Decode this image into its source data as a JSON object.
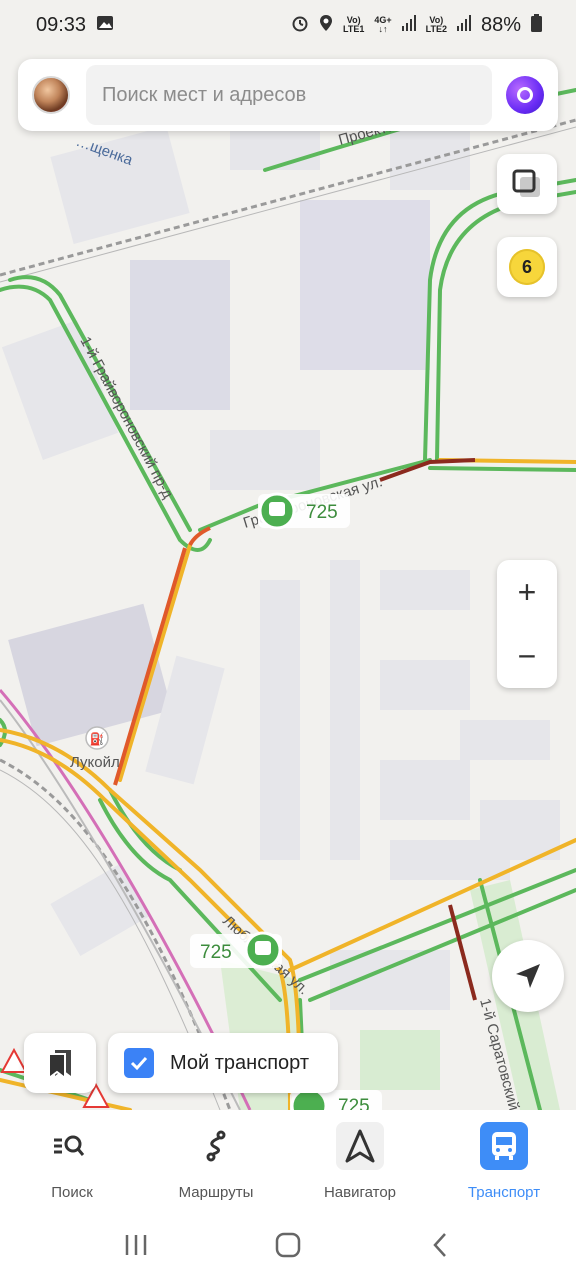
{
  "status_bar": {
    "time": "09:33",
    "battery": "88%",
    "sim1": "LTE1",
    "sim2": "LTE2",
    "net_type": "4G+"
  },
  "search": {
    "placeholder": "Поиск мест и адресов"
  },
  "traffic": {
    "level": "6"
  },
  "map": {
    "labels": {
      "street_top": "…щенка",
      "street_proekt": "Проект…",
      "street_proezd": "1-й Грайвороновский пр-д",
      "street_main": "Грайвороновская ул.",
      "gas_station": "Лукойл",
      "street_lyub": "Люблинская ул.",
      "street_saratov": "1-й Саратовский…"
    },
    "bus_routes": [
      {
        "number": "725"
      },
      {
        "number": "725"
      },
      {
        "number": "725"
      }
    ]
  },
  "zoom": {
    "plus": "+",
    "minus": "−"
  },
  "my_transport": {
    "label": "Мой транспорт",
    "checked": true
  },
  "bottom_nav": {
    "items": [
      {
        "label": "Поиск",
        "icon": "search-list-icon"
      },
      {
        "label": "Маршруты",
        "icon": "route-icon"
      },
      {
        "label": "Навигатор",
        "icon": "navigator-arrow-icon"
      },
      {
        "label": "Транспорт",
        "icon": "bus-icon"
      }
    ]
  },
  "colors": {
    "accent": "#3e8df7",
    "road_free": "#5cb85c",
    "road_slow": "#f0b429",
    "road_jam": "#e0592a",
    "road_heavy": "#8b2a1e",
    "bus_stop": "#4caf50"
  }
}
